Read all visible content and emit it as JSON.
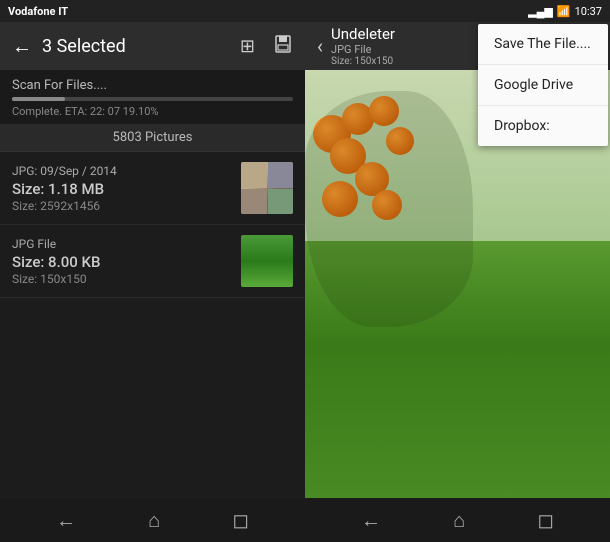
{
  "status_bar": {
    "carrier": "Vodafone IT",
    "time": "10:37",
    "icons_right": "signal wifi battery"
  },
  "left_panel": {
    "toolbar": {
      "back_label": "←",
      "title": "3 Selected",
      "grid_icon": "⊞",
      "save_icon": "💾"
    },
    "scan": {
      "label": "Scan For Files....",
      "status": "Complete. ETA: 22: 07 19.10%",
      "progress_percent": 19
    },
    "pictures_header": "5803 Pictures",
    "files": [
      {
        "type": "JPG: 09/Sep / 2014",
        "size_label": "Size: 1.18 MB",
        "dims": "Size: 2592x1456",
        "thumb_type": "grid"
      },
      {
        "type": "JPG File",
        "size_label": "Size: 8.00 KB",
        "dims": "Size: 150x150",
        "thumb_type": "green"
      }
    ]
  },
  "right_panel": {
    "toolbar": {
      "back_label": "‹",
      "title_main": "Undeleter",
      "title_sub": "JPG File",
      "title_size": "Size: 150x150"
    }
  },
  "dropdown": {
    "items": [
      "Save The File....",
      "Google Drive",
      "Dropbox:"
    ]
  },
  "bottom_nav": {
    "left_icons": [
      "←",
      "⌂",
      "◻"
    ],
    "right_icons": [
      "←",
      "⌂",
      "◻"
    ]
  }
}
